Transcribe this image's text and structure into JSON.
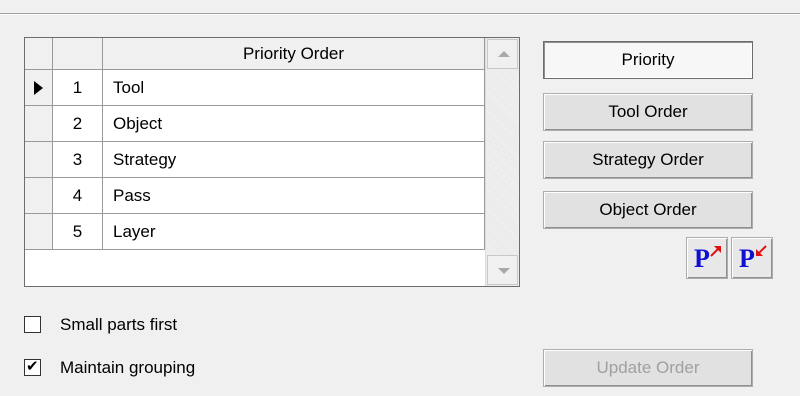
{
  "grid": {
    "header": "Priority Order",
    "selected_row_index": 0,
    "rows": [
      {
        "num": "1",
        "name": "Tool"
      },
      {
        "num": "2",
        "name": "Object"
      },
      {
        "num": "3",
        "name": "Strategy"
      },
      {
        "num": "4",
        "name": "Pass"
      },
      {
        "num": "5",
        "name": "Layer"
      }
    ]
  },
  "buttons": {
    "priority": "Priority",
    "tool_order": "Tool Order",
    "strategy_order": "Strategy Order",
    "object_order": "Object Order",
    "update_order": "Update Order",
    "move_up_icon": "P",
    "move_down_icon": "P"
  },
  "options": {
    "small_parts_first": {
      "label": "Small parts first",
      "checked": false
    },
    "maintain_grouping": {
      "label": "Maintain grouping",
      "checked": true
    }
  },
  "colors": {
    "icon_letter": "#1010d0",
    "icon_arrow": "#e01010"
  }
}
